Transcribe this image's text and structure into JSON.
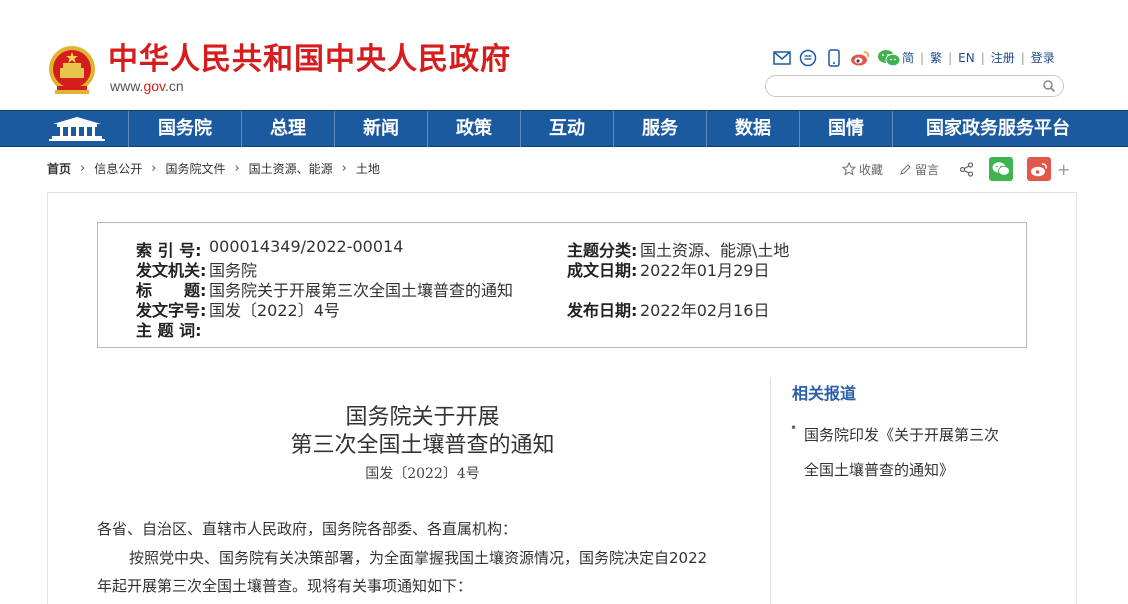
{
  "header": {
    "site_title": "中华人民共和国中央人民政府",
    "site_url_prefix": "www.",
    "site_url_domain": "gov",
    "site_url_suffix": ".cn",
    "top_links": [
      "简",
      "繁",
      "EN",
      "注册",
      "登录"
    ],
    "search_placeholder": ""
  },
  "nav": {
    "items": [
      "国务院",
      "总理",
      "新闻",
      "政策",
      "互动",
      "服务",
      "数据",
      "国情",
      "国家政务服务平台"
    ]
  },
  "breadcrumb": [
    "首页",
    "信息公开",
    "国务院文件",
    "国土资源、能源",
    "土地"
  ],
  "tools": {
    "favorite": "收藏",
    "comment": "留言"
  },
  "meta": {
    "index_label": "索 引 号:",
    "index_value": "000014349/2022-00014",
    "topic_label": "主题分类:",
    "topic_value": "国土资源、能源\\土地",
    "issuer_label": "发文机关:",
    "issuer_value": "国务院",
    "written_label": "成文日期:",
    "written_value": "2022年01月29日",
    "title_label": "标　　题:",
    "title_value": "国务院关于开展第三次全国土壤普查的通知",
    "docno_label": "发文字号:",
    "docno_value": "国发〔2022〕4号",
    "published_label": "发布日期:",
    "published_value": "2022年02月16日",
    "keywords_label": "主 题 词:",
    "keywords_value": ""
  },
  "document": {
    "title_line1": "国务院关于开展",
    "title_line2": "第三次全国土壤普查的通知",
    "number": "国发〔2022〕4号",
    "salutation": "各省、自治区、直辖市人民政府，国务院各部委、各直属机构：",
    "para1_line1": "按照党中央、国务院有关决策部署，为全面掌握我国土壤资源情况，国务院决定自2022",
    "para1_line2": "年起开展第三次全国土壤普查。现将有关事项通知如下："
  },
  "sidebar": {
    "title": "相关报道",
    "items": [
      {
        "line1": "国务院印发《关于开展第三次",
        "line2": "全国土壤普查的通知》"
      }
    ]
  },
  "colors": {
    "brand_red": "#d61d1d",
    "nav_blue": "#1c5aa0",
    "link_blue": "#2b5ea8",
    "wechat_green": "#3fb34f",
    "weibo_red": "#e2574c"
  }
}
